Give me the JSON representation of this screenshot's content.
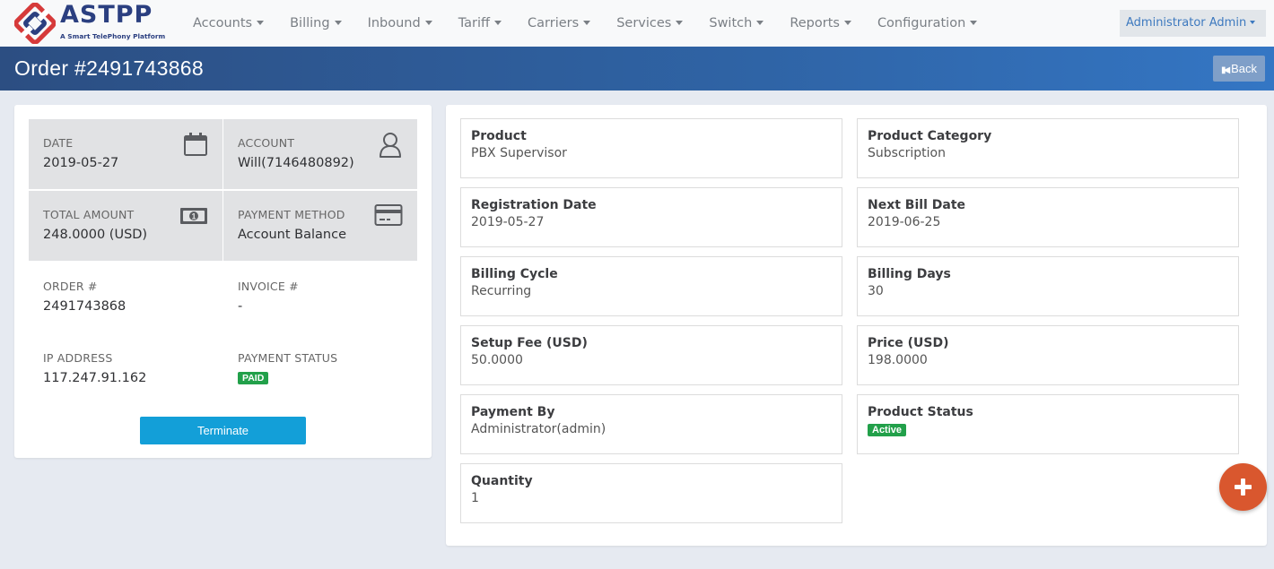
{
  "brand": {
    "name": "ASTPP",
    "tagline": "A Smart TelePhony Platform",
    "colors": {
      "red": "#d63a3a",
      "navy": "#2b3f80"
    }
  },
  "nav": {
    "items": [
      {
        "label": "Accounts"
      },
      {
        "label": "Billing"
      },
      {
        "label": "Inbound"
      },
      {
        "label": "Tariff"
      },
      {
        "label": "Carriers"
      },
      {
        "label": "Services"
      },
      {
        "label": "Switch"
      },
      {
        "label": "Reports"
      },
      {
        "label": "Configuration"
      }
    ],
    "user_menu": "Administrator Admin"
  },
  "page": {
    "title": "Order #2491743868",
    "back_label": "Back"
  },
  "summary": {
    "date": {
      "label": "DATE",
      "value": "2019-05-27",
      "icon": "calendar-icon"
    },
    "account": {
      "label": "ACCOUNT",
      "value": "Will(7146480892)",
      "icon": "user-icon"
    },
    "total_amount": {
      "label": "TOTAL AMOUNT",
      "value": "248.0000 (USD)",
      "icon": "money-icon"
    },
    "payment_method": {
      "label": "PAYMENT METHOD",
      "value": "Account Balance",
      "icon": "credit-card-icon"
    },
    "order_no": {
      "label": "ORDER #",
      "value": "2491743868"
    },
    "invoice_no": {
      "label": "INVOICE #",
      "value": "-"
    },
    "ip_address": {
      "label": "IP ADDRESS",
      "value": "117.247.91.162"
    },
    "payment_status": {
      "label": "PAYMENT STATUS",
      "value": "PAID"
    },
    "terminate_label": "Terminate"
  },
  "details": {
    "product": {
      "label": "Product",
      "value": "PBX Supervisor"
    },
    "product_category": {
      "label": "Product Category",
      "value": "Subscription"
    },
    "registration_date": {
      "label": "Registration Date",
      "value": "2019-05-27"
    },
    "next_bill_date": {
      "label": "Next Bill Date",
      "value": "2019-06-25"
    },
    "billing_cycle": {
      "label": "Billing Cycle",
      "value": "Recurring"
    },
    "billing_days": {
      "label": "Billing Days",
      "value": "30"
    },
    "setup_fee": {
      "label": "Setup Fee (USD)",
      "value": "50.0000"
    },
    "price": {
      "label": "Price (USD)",
      "value": "198.0000"
    },
    "payment_by": {
      "label": "Payment By",
      "value": "Administrator(admin)"
    },
    "product_status": {
      "label": "Product Status",
      "value": "Active"
    },
    "quantity": {
      "label": "Quantity",
      "value": "1"
    }
  },
  "colors": {
    "status_green": "#22a04a",
    "primary_button": "#139fd8",
    "fab": "#d9572e"
  }
}
